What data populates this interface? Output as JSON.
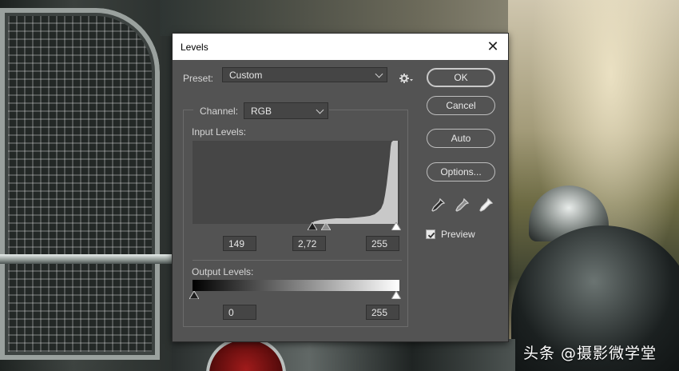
{
  "dialog": {
    "title": "Levels",
    "close_icon": "close-icon",
    "preset_label": "Preset:",
    "preset_value": "Custom",
    "channel_label": "Channel:",
    "channel_value": "RGB",
    "input_levels_label": "Input Levels:",
    "input_levels": {
      "black": "149",
      "gamma": "2,72",
      "white": "255"
    },
    "output_levels_label": "Output Levels:",
    "output_levels": {
      "black": "0",
      "white": "255"
    },
    "buttons": {
      "ok": "OK",
      "cancel": "Cancel",
      "auto": "Auto",
      "options": "Options..."
    },
    "preview_label": "Preview",
    "preview_checked": true,
    "eyedroppers": [
      "black-point-eyedropper-icon",
      "gray-point-eyedropper-icon",
      "white-point-eyedropper-icon"
    ]
  },
  "watermark": "头条 @摄影微学堂",
  "colors": {
    "dialog_bg": "#535353",
    "field_bg": "#454545",
    "histogram_fill": "#c8c8c8",
    "titlebar_bg": "#ffffff"
  }
}
